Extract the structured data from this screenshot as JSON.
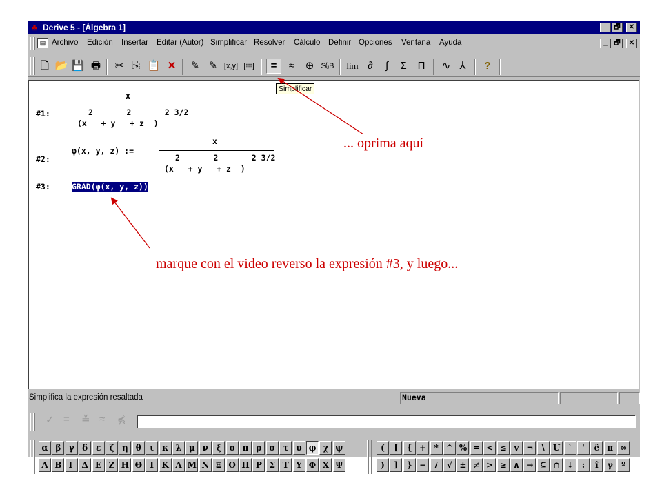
{
  "window": {
    "title": "Derive 5 - [Álgebra 1]",
    "app_icon": "derive-logo-icon",
    "buttons": [
      "_",
      "🗗",
      "✕"
    ]
  },
  "menubar": {
    "items": [
      "Archivo",
      "Edición",
      "Insertar",
      "Editar (Autor)",
      "Simplificar",
      "Resolver",
      "Cálculo",
      "Definir",
      "Opciones",
      "Ventana",
      "Ayuda"
    ],
    "buttons": [
      "_",
      "🗗",
      "✕"
    ]
  },
  "toolbar": {
    "new": "🗋",
    "open": "📂",
    "save": "💾",
    "print": "🖶",
    "cut": "✂",
    "copy": "⎘",
    "paste": "📋",
    "delete": "✕",
    "author_expr": "✎",
    "author_text": "✎",
    "vector": "[x,y]",
    "matrix": "[⁞⁞⁞]",
    "simplify": "=",
    "approximate": "≈",
    "zoom": "⊕",
    "substitute": "S̸ᵤB",
    "limit": "lim",
    "derivative": "∂",
    "integral": "∫",
    "sum": "Σ",
    "product": "Π",
    "plot2d": "∿",
    "plot3d": "⅄",
    "help": "?"
  },
  "tooltip": "Simplificar",
  "expressions": {
    "e1": {
      "label": "#1:",
      "num": "x",
      "den_exp": "2       2       2 3/2",
      "den": "(x   + y   + z  )"
    },
    "e2": {
      "label": "#2:",
      "lhs": "φ(x, y, z) :=",
      "num": "x",
      "den_exp": "2       2       2 3/2",
      "den": "(x   + y   + z  )"
    },
    "e3": {
      "label": "#3:",
      "text": "GRAD(φ(x, y, z))"
    }
  },
  "status": {
    "message": "Simplifica la expresión resaltada",
    "mode": "Nueva"
  },
  "entry": {
    "buttons": [
      "✓",
      "=",
      "≚",
      "≈",
      "⋠"
    ],
    "value": ""
  },
  "symbols": {
    "greek_row1": [
      "α",
      "β",
      "γ",
      "δ",
      "ε",
      "ζ",
      "η",
      "θ",
      "ι",
      "κ",
      "λ",
      "μ",
      "ν",
      "ξ",
      "ο",
      "π",
      "ρ",
      "σ",
      "τ",
      "υ",
      "φ",
      "χ",
      "ψ"
    ],
    "greek_row2": [
      "A",
      "B",
      "Γ",
      "Δ",
      "E",
      "Z",
      "H",
      "Θ",
      "I",
      "K",
      "Λ",
      "M",
      "N",
      "Ξ",
      "O",
      "Π",
      "P",
      "Σ",
      "T",
      "Υ",
      "Φ",
      "X",
      "Ψ"
    ],
    "math_row1": [
      "(",
      "[",
      "{",
      "+",
      "*",
      "^",
      "%",
      "=",
      "<",
      "≤",
      "v",
      "¬",
      "\\",
      "U",
      "`",
      "'",
      "ê",
      "π",
      "∞"
    ],
    "math_row2": [
      ")",
      "]",
      "}",
      "−",
      "/",
      "√",
      "±",
      "≠",
      ">",
      "≥",
      "∧",
      "→",
      "⊆",
      "∩",
      "↓",
      ":",
      "î",
      "γ",
      "º"
    ]
  },
  "annotations": {
    "top": "... oprima aquí",
    "bottom": "marque con el video reverso la expresión  #3, y luego..."
  },
  "colors": {
    "titlebar": "#000080",
    "selection": "#000080",
    "annotation": "#cc0000"
  }
}
